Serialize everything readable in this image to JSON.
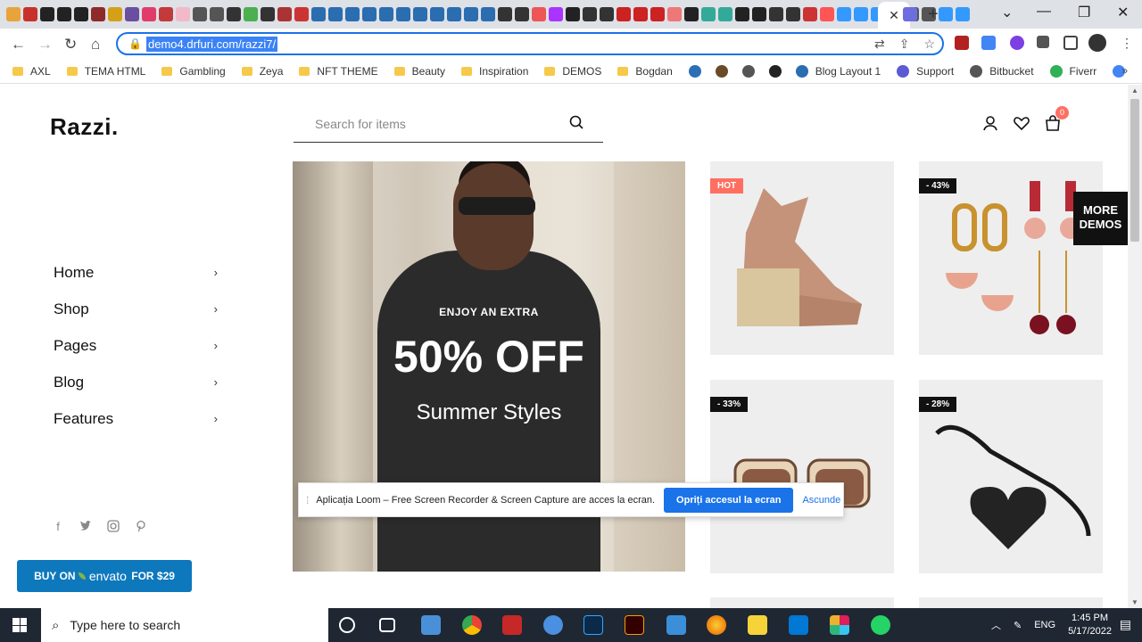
{
  "browser": {
    "url": "demo4.drfuri.com/razzi7/",
    "bookmarks": [
      {
        "label": "AXL",
        "type": "folder"
      },
      {
        "label": "TEMA HTML",
        "type": "folder"
      },
      {
        "label": "Gambling",
        "type": "folder"
      },
      {
        "label": "Zeya",
        "type": "folder"
      },
      {
        "label": "NFT THEME",
        "type": "folder"
      },
      {
        "label": "Beauty",
        "type": "folder"
      },
      {
        "label": "Inspiration",
        "type": "folder"
      },
      {
        "label": "DEMOS",
        "type": "folder"
      },
      {
        "label": "Bogdan",
        "type": "folder"
      },
      {
        "label": "Blog Layout 1",
        "type": "link"
      },
      {
        "label": "Support",
        "type": "link"
      },
      {
        "label": "Bitbucket",
        "type": "link"
      },
      {
        "label": "Fiverr",
        "type": "link"
      }
    ],
    "new_tab_symbol": "+",
    "tab_close_symbol": "✕",
    "more_bookmarks_symbol": "»"
  },
  "site": {
    "logo": "Razzi.",
    "search_placeholder": "Search for items",
    "cart_count": "0",
    "menu": [
      {
        "label": "Home"
      },
      {
        "label": "Shop"
      },
      {
        "label": "Pages"
      },
      {
        "label": "Blog"
      },
      {
        "label": "Features"
      }
    ],
    "buy": {
      "prefix": "BUY ON",
      "brand": "envato",
      "suffix": "FOR $29"
    },
    "hero": {
      "pre": "ENJOY AN EXTRA",
      "big": "50% OFF",
      "sub": "Summer Styles"
    },
    "products": [
      {
        "badge": "HOT",
        "badge_color": "#ff6f61",
        "item": "sandal"
      },
      {
        "badge": "- 43%",
        "badge_color": "#111111",
        "item": "earrings"
      },
      {
        "badge": "- 33%",
        "badge_color": "#111111",
        "item": "sunglasses"
      },
      {
        "badge": "- 28%",
        "badge_color": "#111111",
        "item": "heart-bag"
      }
    ],
    "more_demos": "MORE DEMOS"
  },
  "loom": {
    "text": "Aplicația Loom – Free Screen Recorder & Screen Capture are acces la ecran.",
    "stop": "Opriți accesul la ecran",
    "hide": "Ascunde"
  },
  "taskbar": {
    "search": "Type here to search",
    "lang": "ENG",
    "time": "1:45 PM",
    "date": "5/17/2022"
  }
}
